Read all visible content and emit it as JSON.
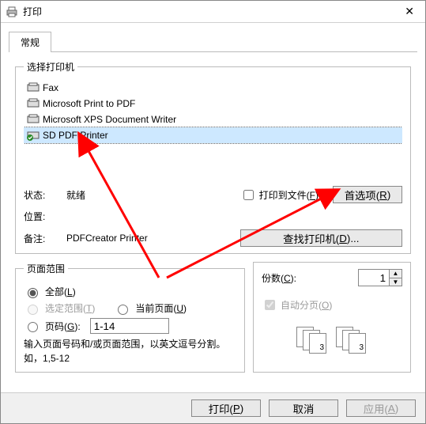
{
  "window": {
    "title": "打印"
  },
  "tabs": {
    "general": "常规"
  },
  "printers": {
    "legend": "选择打印机",
    "items": [
      {
        "name": "Fax",
        "selected": false
      },
      {
        "name": "Microsoft Print to PDF",
        "selected": false
      },
      {
        "name": "Microsoft XPS Document Writer",
        "selected": false
      },
      {
        "name": "SD PDF Printer",
        "selected": true
      }
    ],
    "status_label": "状态:",
    "status_value": "就绪",
    "location_label": "位置:",
    "location_value": "",
    "comment_label": "备注:",
    "comment_value": "PDFCreator Printer",
    "print_to_file_label_pre": "打印到文件(",
    "print_to_file_key": "F",
    "print_to_file_label_post": ")",
    "prefs_pre": "首选项(",
    "prefs_key": "R",
    "prefs_post": ")",
    "find_pre": "查找打印机(",
    "find_key": "D",
    "find_post": ")..."
  },
  "range": {
    "legend": "页面范围",
    "all_pre": "全部(",
    "all_key": "L",
    "all_post": ")",
    "selection_pre": "选定范围(",
    "selection_key": "T",
    "selection_post": ")",
    "current_pre": "当前页面(",
    "current_key": "U",
    "current_post": ")",
    "pages_pre": "页码(",
    "pages_key": "G",
    "pages_post": "):",
    "pages_value": "1-14",
    "note": "输入页面号码和/或页面范围，以英文逗号分割。如，1,5-12"
  },
  "copies": {
    "count_pre": "份数(",
    "count_key": "C",
    "count_post": "):",
    "count_value": "1",
    "collate_pre": "自动分页(",
    "collate_key": "O",
    "collate_post": ")"
  },
  "footer": {
    "print_pre": "打印(",
    "print_key": "P",
    "print_post": ")",
    "cancel": "取消",
    "apply_pre": "应用(",
    "apply_key": "A",
    "apply_post": ")"
  }
}
